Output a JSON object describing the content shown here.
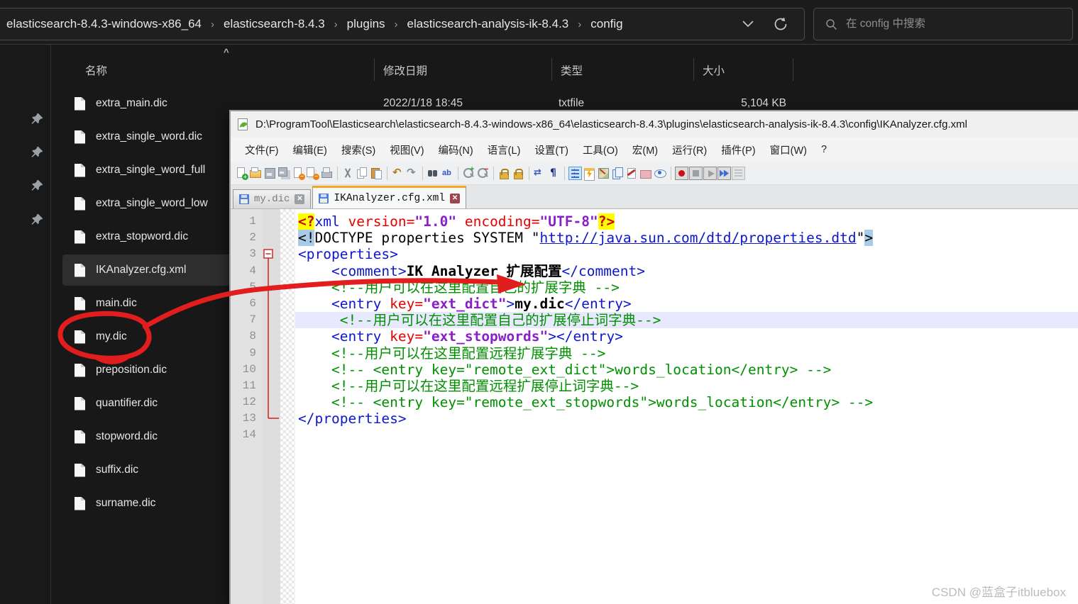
{
  "explorer": {
    "breadcrumb": [
      "elasticsearch-8.4.3-windows-x86_64",
      "elasticsearch-8.4.3",
      "plugins",
      "elasticsearch-analysis-ik-8.4.3",
      "config"
    ],
    "search_placeholder": "在 config 中搜索",
    "columns": {
      "name": "名称",
      "date": "修改日期",
      "type": "类型",
      "size": "大小"
    },
    "files": [
      {
        "name": "extra_main.dic",
        "date": "2022/1/18 18:45",
        "type": "txtfile",
        "size": "5,104 KB"
      },
      {
        "name": "extra_single_word.dic"
      },
      {
        "name": "extra_single_word_full"
      },
      {
        "name": "extra_single_word_low"
      },
      {
        "name": "extra_stopword.dic"
      },
      {
        "name": "IKAnalyzer.cfg.xml",
        "selected": true
      },
      {
        "name": "main.dic"
      },
      {
        "name": "my.dic"
      },
      {
        "name": "preposition.dic"
      },
      {
        "name": "quantifier.dic"
      },
      {
        "name": "stopword.dic"
      },
      {
        "name": "suffix.dic"
      },
      {
        "name": "surname.dic"
      }
    ]
  },
  "notepad": {
    "title": "D:\\ProgramTool\\Elasticsearch\\elasticsearch-8.4.3-windows-x86_64\\elasticsearch-8.4.3\\plugins\\elasticsearch-analysis-ik-8.4.3\\config\\IKAnalyzer.cfg.xml",
    "menus": [
      "文件(F)",
      "编辑(E)",
      "搜索(S)",
      "视图(V)",
      "编码(N)",
      "语言(L)",
      "设置(T)",
      "工具(O)",
      "宏(M)",
      "运行(R)",
      "插件(P)",
      "窗口(W)",
      "?"
    ],
    "toolbar": [
      {
        "name": "new-file",
        "kind": "new"
      },
      {
        "name": "open-file",
        "kind": "open"
      },
      {
        "name": "save",
        "kind": "save"
      },
      {
        "name": "save-all",
        "kind": "saveall"
      },
      {
        "name": "close",
        "kind": "close"
      },
      {
        "name": "close-all",
        "kind": "closeall"
      },
      {
        "name": "print",
        "kind": "print"
      },
      {
        "kind": "sep"
      },
      {
        "name": "cut",
        "kind": "cut"
      },
      {
        "name": "copy",
        "kind": "copy"
      },
      {
        "name": "paste",
        "kind": "paste"
      },
      {
        "kind": "sep"
      },
      {
        "name": "undo",
        "kind": "undo"
      },
      {
        "name": "redo",
        "kind": "redo"
      },
      {
        "kind": "sep"
      },
      {
        "name": "find",
        "kind": "find"
      },
      {
        "name": "replace",
        "kind": "replace"
      },
      {
        "kind": "sep"
      },
      {
        "name": "zoom-in",
        "kind": "zoomin"
      },
      {
        "name": "zoom-out",
        "kind": "zoomout"
      },
      {
        "kind": "sep"
      },
      {
        "name": "sync-vertical-scrolling",
        "kind": "lock"
      },
      {
        "name": "sync-horizontal-scrolling",
        "kind": "lock"
      },
      {
        "kind": "sep"
      },
      {
        "name": "word-wrap",
        "kind": "wrap"
      },
      {
        "name": "show-all-characters",
        "kind": "pilcrow"
      },
      {
        "kind": "sep"
      },
      {
        "name": "indent-guide",
        "kind": "indent"
      },
      {
        "name": "function-list",
        "kind": "funclist"
      },
      {
        "name": "document-map",
        "kind": "docmap"
      },
      {
        "name": "document-list",
        "kind": "doclist"
      },
      {
        "name": "document-switcher",
        "kind": "docswitch"
      },
      {
        "name": "folder-as-workspace",
        "kind": "folderws"
      },
      {
        "name": "file-monitoring",
        "kind": "monitor"
      },
      {
        "kind": "sep"
      },
      {
        "name": "macro-record",
        "kind": "record",
        "frame": true
      },
      {
        "name": "macro-stop",
        "kind": "stop",
        "frame": true
      },
      {
        "name": "macro-play",
        "kind": "play",
        "frame": true
      },
      {
        "name": "macro-run-multiple",
        "kind": "ff",
        "frame": true
      },
      {
        "name": "macro-save",
        "kind": "savemacro",
        "frame": true
      }
    ],
    "tabs": [
      {
        "label": "my.dic",
        "active": false
      },
      {
        "label": "IKAnalyzer.cfg.xml",
        "active": true
      }
    ],
    "editor": {
      "lines": [
        {
          "n": 1,
          "tokens": [
            [
              "pi",
              "<?"
            ],
            [
              "tag",
              "xml"
            ],
            [
              "def",
              " "
            ],
            [
              "attr",
              "version="
            ],
            [
              "val",
              "\"1.0\""
            ],
            [
              "def",
              " "
            ],
            [
              "attr",
              "encoding="
            ],
            [
              "val",
              "\"UTF-8\""
            ],
            [
              "pi",
              "?>"
            ]
          ]
        },
        {
          "n": 2,
          "tokens": [
            [
              "hlb",
              "<!"
            ],
            [
              "def",
              "DOCTYPE properties SYSTEM \""
            ],
            [
              "url",
              "http://java.sun.com/dtd/properties.dtd"
            ],
            [
              "def",
              "\""
            ],
            [
              "hlb",
              ">"
            ]
          ]
        },
        {
          "n": 3,
          "tokens": [
            [
              "tag",
              "<properties>"
            ]
          ]
        },
        {
          "n": 4,
          "tokens": [
            [
              "def",
              "    "
            ],
            [
              "tag",
              "<comment>"
            ],
            [
              "txt",
              "IK Analyzer 扩展配置"
            ],
            [
              "tag",
              "</comment>"
            ]
          ]
        },
        {
          "n": 5,
          "tokens": [
            [
              "def",
              "    "
            ],
            [
              "com",
              "<!--用户可以在这里配置自己的扩展字典 -->"
            ]
          ]
        },
        {
          "n": 6,
          "tokens": [
            [
              "def",
              "    "
            ],
            [
              "tag",
              "<entry"
            ],
            [
              "def",
              " "
            ],
            [
              "attr",
              "key="
            ],
            [
              "val",
              "\"ext_dict\""
            ],
            [
              "tag",
              ">"
            ],
            [
              "txt",
              "my.dic"
            ],
            [
              "tag",
              "</entry>"
            ]
          ]
        },
        {
          "n": 7,
          "hl": true,
          "tokens": [
            [
              "def",
              "     "
            ],
            [
              "com",
              "<!--用户可以在这里配置自己的扩展停止词字典-->"
            ]
          ]
        },
        {
          "n": 8,
          "tokens": [
            [
              "def",
              "    "
            ],
            [
              "tag",
              "<entry"
            ],
            [
              "def",
              " "
            ],
            [
              "attr",
              "key="
            ],
            [
              "val",
              "\"ext_stopwords\""
            ],
            [
              "tag",
              ">"
            ],
            [
              "tag",
              "</entry>"
            ]
          ]
        },
        {
          "n": 9,
          "tokens": [
            [
              "def",
              "    "
            ],
            [
              "com",
              "<!--用户可以在这里配置远程扩展字典 -->"
            ]
          ]
        },
        {
          "n": 10,
          "tokens": [
            [
              "def",
              "    "
            ],
            [
              "com",
              "<!-- <entry key=\"remote_ext_dict\">words_location</entry> -->"
            ]
          ]
        },
        {
          "n": 11,
          "tokens": [
            [
              "def",
              "    "
            ],
            [
              "com",
              "<!--用户可以在这里配置远程扩展停止词字典-->"
            ]
          ]
        },
        {
          "n": 12,
          "tokens": [
            [
              "def",
              "    "
            ],
            [
              "com",
              "<!-- <entry key=\"remote_ext_stopwords\">words_location</entry> -->"
            ]
          ]
        },
        {
          "n": 13,
          "tokens": [
            [
              "tag",
              "</properties>"
            ]
          ]
        },
        {
          "n": 14,
          "tokens": []
        }
      ]
    }
  },
  "watermark": {
    "text": "CSDN @蓝盒子itbluebox"
  },
  "colors": {
    "accent_orange": "#f7a427",
    "annotation_red": "#e11d1d",
    "selection_blue": "#a8cbe8",
    "current_line": "#e8e8ff"
  }
}
